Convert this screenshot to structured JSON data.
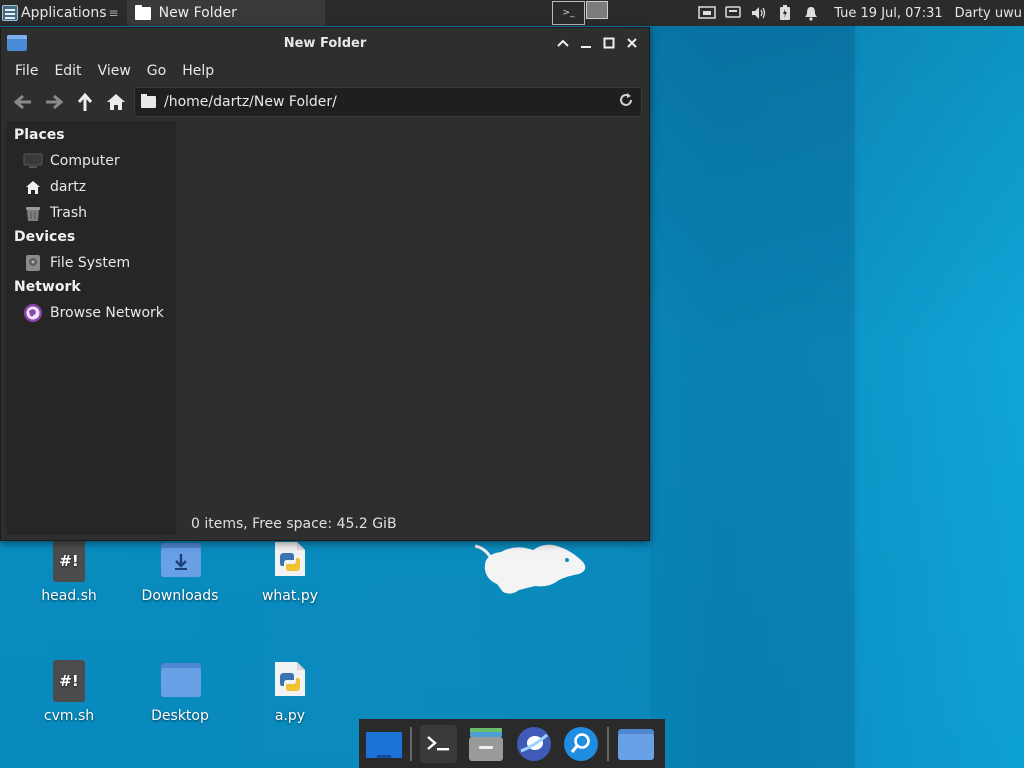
{
  "top_panel": {
    "applications_label": "Applications",
    "task_title": "New Folder",
    "workspace_label": ">_",
    "clock": "Tue 19 Jul, 07:31",
    "user": "Darty uwu"
  },
  "window": {
    "title": "New Folder",
    "controls": [
      "^",
      "_",
      "□",
      "x"
    ],
    "menu": [
      "File",
      "Edit",
      "View",
      "Go",
      "Help"
    ],
    "path": "/home/dartz/New Folder/",
    "sidebar": {
      "sections": [
        {
          "title": "Places",
          "items": [
            {
              "label": "Computer",
              "icon": "computer-icon"
            },
            {
              "label": "dartz",
              "icon": "home-icon"
            },
            {
              "label": "Trash",
              "icon": "trash-icon"
            }
          ]
        },
        {
          "title": "Devices",
          "items": [
            {
              "label": "File System",
              "icon": "drive-icon"
            }
          ]
        },
        {
          "title": "Network",
          "items": [
            {
              "label": "Browse Network",
              "icon": "network-icon"
            }
          ]
        }
      ]
    },
    "status": "0 items, Free space: 45.2 GiB"
  },
  "desktop": {
    "icons": [
      {
        "label": "head.sh",
        "icon": "script-file-icon"
      },
      {
        "label": "Downloads",
        "icon": "downloads-folder-icon"
      },
      {
        "label": "what.py",
        "icon": "python-file-icon"
      },
      {
        "label": "cvm.sh",
        "icon": "script-file-icon"
      },
      {
        "label": "Desktop",
        "icon": "folder-icon"
      },
      {
        "label": "a.py",
        "icon": "python-file-icon"
      }
    ],
    "script_glyph": "#!"
  },
  "dock": {
    "items": [
      "show-desktop-icon",
      "terminal-icon",
      "file-manager-icon",
      "web-browser-icon",
      "app-finder-icon",
      "home-folder-icon"
    ]
  },
  "colors": {
    "desktop_bg": "#0a8dc0",
    "panel_bg": "#2b2b2b",
    "window_bg": "#2e2e2e",
    "sidebar_bg": "#262626",
    "folder_blue": "#5a8fd6"
  }
}
